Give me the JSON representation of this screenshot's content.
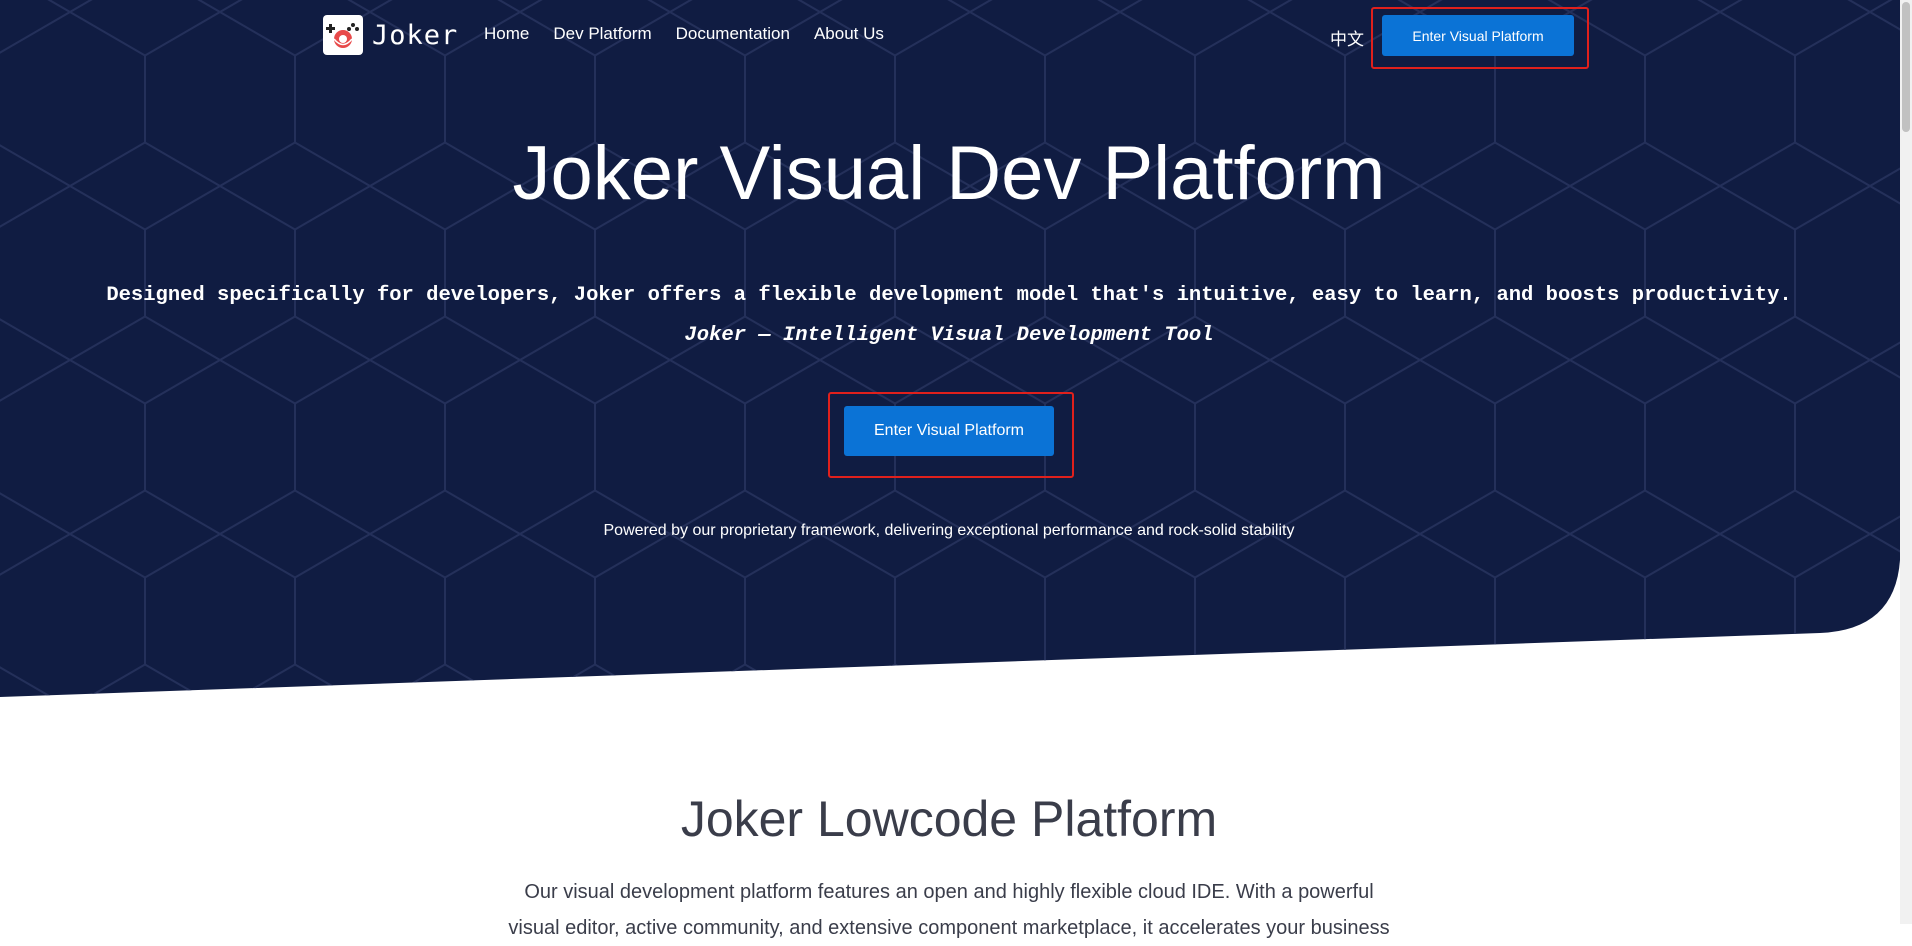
{
  "header": {
    "logo_text": "Joker",
    "nav": [
      "Home",
      "Dev Platform",
      "Documentation",
      "About Us"
    ],
    "lang_label": "中文",
    "cta_label": "Enter Visual Platform"
  },
  "hero": {
    "title": "Joker Visual Dev Platform",
    "description": "Designed specifically for developers, Joker offers a flexible development model that's intuitive, easy to learn, and boosts productivity.",
    "tagline": "Joker — Intelligent Visual Development Tool",
    "cta_label": "Enter Visual Platform",
    "note": "Powered by our proprietary framework, delivering exceptional performance and rock-solid stability"
  },
  "section": {
    "title": "Joker Lowcode Platform",
    "text": "Our visual development platform features an open and highly flexible cloud IDE. With a powerful visual editor, active community, and extensive component marketplace, it accelerates your business"
  },
  "colors": {
    "hero_bg": "#101c42",
    "hex_line": "#232f54",
    "primary": "#0b73d6",
    "highlight": "#e0201c",
    "text_dark": "#3a3d4a"
  },
  "icons": {
    "logo": "joker-logo-icon"
  }
}
